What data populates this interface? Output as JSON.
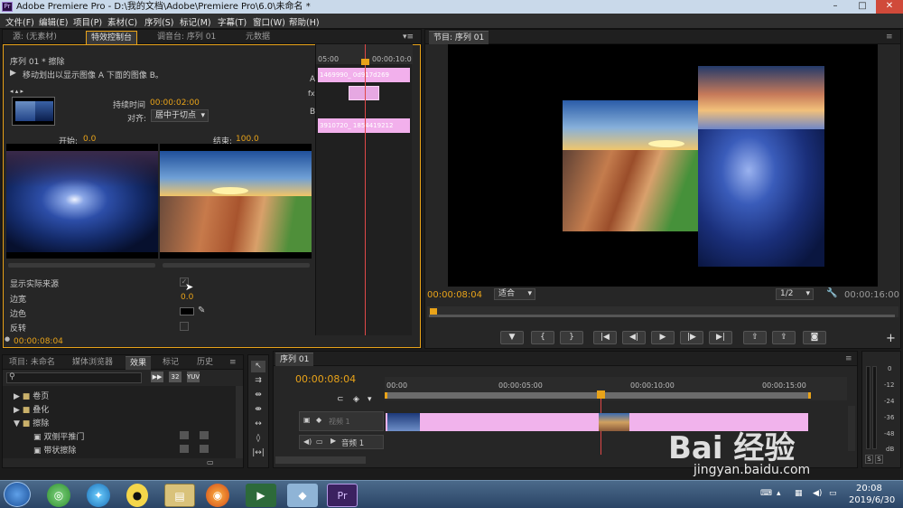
{
  "window": {
    "title": "Adobe Premiere Pro - D:\\我的文档\\Adobe\\Premiere Pro\\6.0\\未命名 *",
    "app_badge": "Pr"
  },
  "menu": [
    "文件(F)",
    "编辑(E)",
    "项目(P)",
    "素材(C)",
    "序列(S)",
    "标记(M)",
    "字幕(T)",
    "窗口(W)",
    "帮助(H)"
  ],
  "top_tabs": {
    "source": "源: (无素材)",
    "effect_controls": "特效控制台",
    "mixer": "调音台: 序列 01",
    "metadata": "元数据",
    "program": "节目: 序列 01"
  },
  "effect": {
    "sequence_path": "序列 01 * 擦除",
    "description": "移动划出以显示图像 A 下面的图像 B。",
    "duration_label": "持续时间",
    "duration_value": "00:00:02:00",
    "align_label": "对齐:",
    "align_value": "居中于切点",
    "start_label": "开始:",
    "start_value": "0.0",
    "end_label": "结束:",
    "end_value": "100.0",
    "show_actual": "显示实际来源",
    "border_width_label": "边宽",
    "border_width_value": "0.0",
    "border_color_label": "边色",
    "reverse_label": "反转",
    "timecode": "00:00:08:04",
    "mini_ruler_start": "05:00",
    "mini_ruler_end": "00:00:10:0",
    "track_a": "A",
    "track_b": "B",
    "clip_a1": "1469990_",
    "clip_a2": "0d917d269",
    "clip_b1": "3910720_",
    "clip_b2": "1854419212"
  },
  "program": {
    "timecode": "00:00:08:04",
    "fit": "适合",
    "resolution": "1/2",
    "duration": "00:00:16:00"
  },
  "project_tabs": [
    "项目: 未命名",
    "媒体浏览器",
    "效果",
    "标记",
    "历史"
  ],
  "effects_tree": [
    {
      "label": "卷页",
      "type": "folder"
    },
    {
      "label": "叠化",
      "type": "folder"
    },
    {
      "label": "擦除",
      "type": "folder"
    },
    {
      "label": "双侧平推门",
      "type": "item"
    },
    {
      "label": "带状擦除",
      "type": "item"
    }
  ],
  "timeline": {
    "tab": "序列 01",
    "timecode": "00:00:08:04",
    "ruler": [
      "00:00",
      "00:00:05:00",
      "00:00:10:00",
      "00:00:15:00"
    ],
    "video_track": "视频 1",
    "audio_track": "音频 1"
  },
  "meter_scale": [
    "0",
    "-12",
    "-24",
    "-36",
    "-48",
    "dB"
  ],
  "meter_solo": [
    "S",
    "S"
  ],
  "watermark": {
    "brand": "Bai  经验",
    "url": "jingyan.baidu.com"
  },
  "taskbar": {
    "time": "20:08",
    "date": "2019/6/30",
    "pr_label": "Pr"
  }
}
